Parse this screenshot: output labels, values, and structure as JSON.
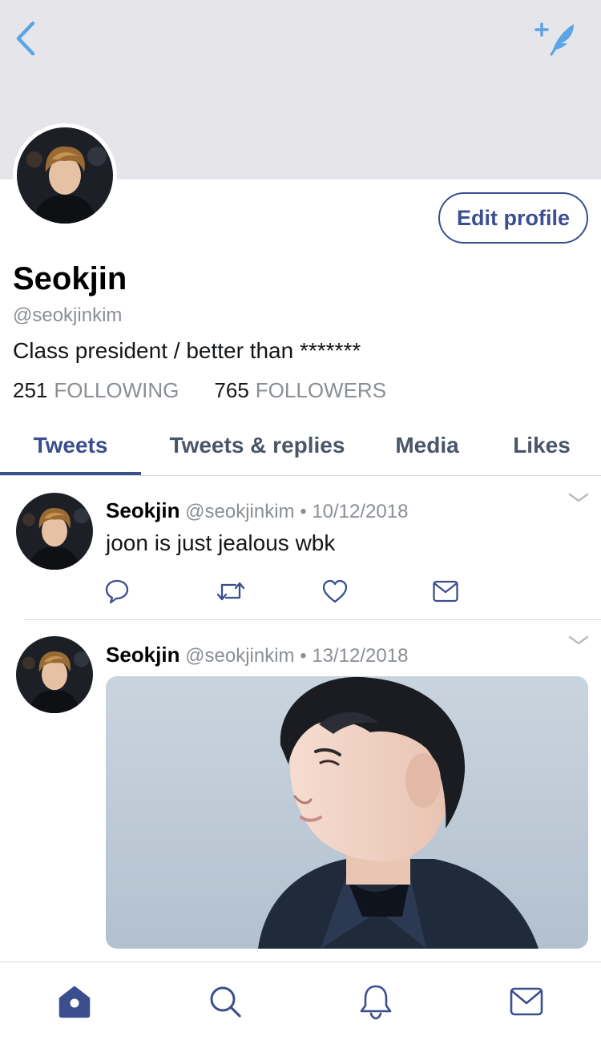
{
  "header": {
    "back_icon": "chevron-left-icon",
    "compose_icon": "compose-tweet-feather-icon",
    "accent_color": "#5ba4e6"
  },
  "profile": {
    "display_name": "Seokjin",
    "handle": "@seokjinkim",
    "bio": "Class president / better than *******",
    "following_count": "251",
    "following_label": "FOLLOWING",
    "followers_count": "765",
    "followers_label": "FOLLOWERS",
    "edit_button_label": "Edit profile",
    "brand_color": "#3b4f8f"
  },
  "tabs": [
    {
      "label": "Tweets",
      "active": true
    },
    {
      "label": "Tweets & replies",
      "active": false
    },
    {
      "label": "Media",
      "active": false
    },
    {
      "label": "Likes",
      "active": false
    }
  ],
  "tweets": [
    {
      "name": "Seokjin",
      "handle": "@seokjinkim",
      "separator": "•",
      "date": "10/12/2018",
      "text": "joon is just jealous wbk",
      "has_media": false
    },
    {
      "name": "Seokjin",
      "handle": "@seokjinkim",
      "separator": "•",
      "date": "13/12/2018",
      "text": "",
      "has_media": true
    }
  ],
  "bottom_nav": [
    {
      "icon": "home-icon",
      "active": true
    },
    {
      "icon": "search-icon",
      "active": false
    },
    {
      "icon": "bell-icon",
      "active": false
    },
    {
      "icon": "envelope-icon",
      "active": false
    }
  ]
}
